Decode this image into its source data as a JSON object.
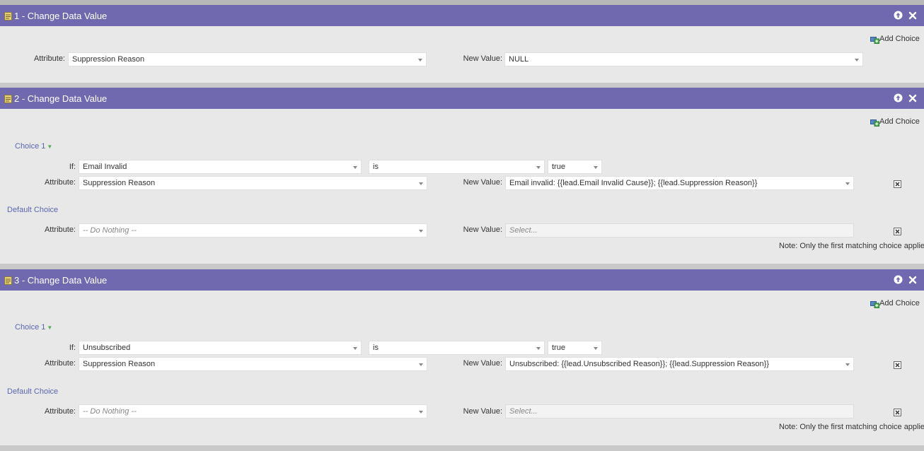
{
  "steps": [
    {
      "title": "1 - Change Data Value",
      "add_choice": "Add Choice",
      "attribute_label": "Attribute:",
      "attribute_value": "Suppression Reason",
      "new_value_label": "New Value:",
      "new_value": "NULL"
    },
    {
      "title": "2 - Change Data Value",
      "add_choice": "Add Choice",
      "choice_label": "Choice 1",
      "if_label": "If:",
      "if_field": "Email Invalid",
      "operator": "is",
      "if_value": "true",
      "attribute_label": "Attribute:",
      "attribute_value": "Suppression Reason",
      "new_value_label": "New Value:",
      "new_value": "Email invalid: {{lead.Email Invalid Cause}}; {{lead.Suppression Reason}}",
      "default_label": "Default Choice",
      "default_attribute_label": "Attribute:",
      "default_attribute_value": "-- Do Nothing --",
      "default_new_value_label": "New Value:",
      "default_new_value_placeholder": "Select...",
      "note": "Note: Only the first matching choice applies"
    },
    {
      "title": "3 - Change Data Value",
      "add_choice": "Add Choice",
      "choice_label": "Choice 1",
      "if_label": "If:",
      "if_field": "Unsubscribed",
      "operator": "is",
      "if_value": "true",
      "attribute_label": "Attribute:",
      "attribute_value": "Suppression Reason",
      "new_value_label": "New Value:",
      "new_value": "Unsubscribed: {{lead.Unsubscribed Reason}}; {{lead.Suppression Reason}}",
      "default_label": "Default Choice",
      "default_attribute_label": "Attribute:",
      "default_attribute_value": "-- Do Nothing --",
      "default_new_value_label": "New Value:",
      "default_new_value_placeholder": "Select...",
      "note": "Note: Only the first matching choice applies"
    }
  ],
  "icons": {
    "step": "flow-step-icon",
    "move_up": "arrow-up-circle-icon",
    "close": "close-icon",
    "add_choice": "add-choice-icon",
    "delete_choice": "delete-choice-icon"
  },
  "colors": {
    "header_bg": "#7069b0",
    "panel_bg": "#e8e8e8",
    "link": "#5b66b0",
    "choice_arrow": "#5aa65a"
  }
}
